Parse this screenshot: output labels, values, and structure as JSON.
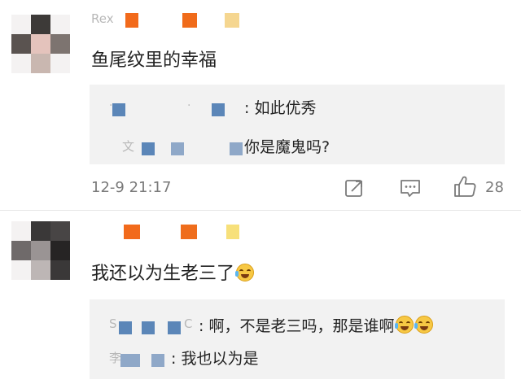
{
  "comments": [
    {
      "avatar_colors": [
        "#3d3a38",
        "#7d7470",
        "#c9b7b0",
        "#5a5350",
        "#e4d3ce",
        "#2a2726"
      ],
      "name_blocks": [
        "#f26a1b",
        "#f06b1a",
        "#f5d690"
      ],
      "text": "鱼尾纹里的幸福",
      "replies": [
        {
          "name_fragments": [
            "·",
            "·"
          ],
          "text": ": 如此优秀",
          "emojis": 0
        },
        {
          "name_fragments": [
            "文",
            ""
          ],
          "text": "你是魔鬼吗?",
          "emojis": 0
        }
      ],
      "timestamp": "12-9 21:17",
      "like_count": "28"
    },
    {
      "avatar_colors": [
        "#3a3838",
        "#6f6a6a",
        "#9a9494",
        "#484545",
        "#bdb6b5",
        "#262424"
      ],
      "name_blocks": [
        "#f26a1b",
        "#ef6d1c",
        "#f7e07a"
      ],
      "text": "我还以为生老三了",
      "text_emojis": 1,
      "replies": [
        {
          "name_fragments": [
            "S",
            "C"
          ],
          "text": ": 啊，不是老三吗，那是谁啊",
          "emojis": 2
        },
        {
          "name_fragments": [
            "李",
            ""
          ],
          "text": ": 我也以为是",
          "emojis": 0
        }
      ]
    }
  ],
  "icons": {
    "share": "share-icon",
    "comment": "comment-icon",
    "like": "like-icon"
  },
  "colors": {
    "reply_bg": "#f2f2f2",
    "meta_text": "#7a7a7a",
    "name_block_blue": "#5b86b8"
  }
}
